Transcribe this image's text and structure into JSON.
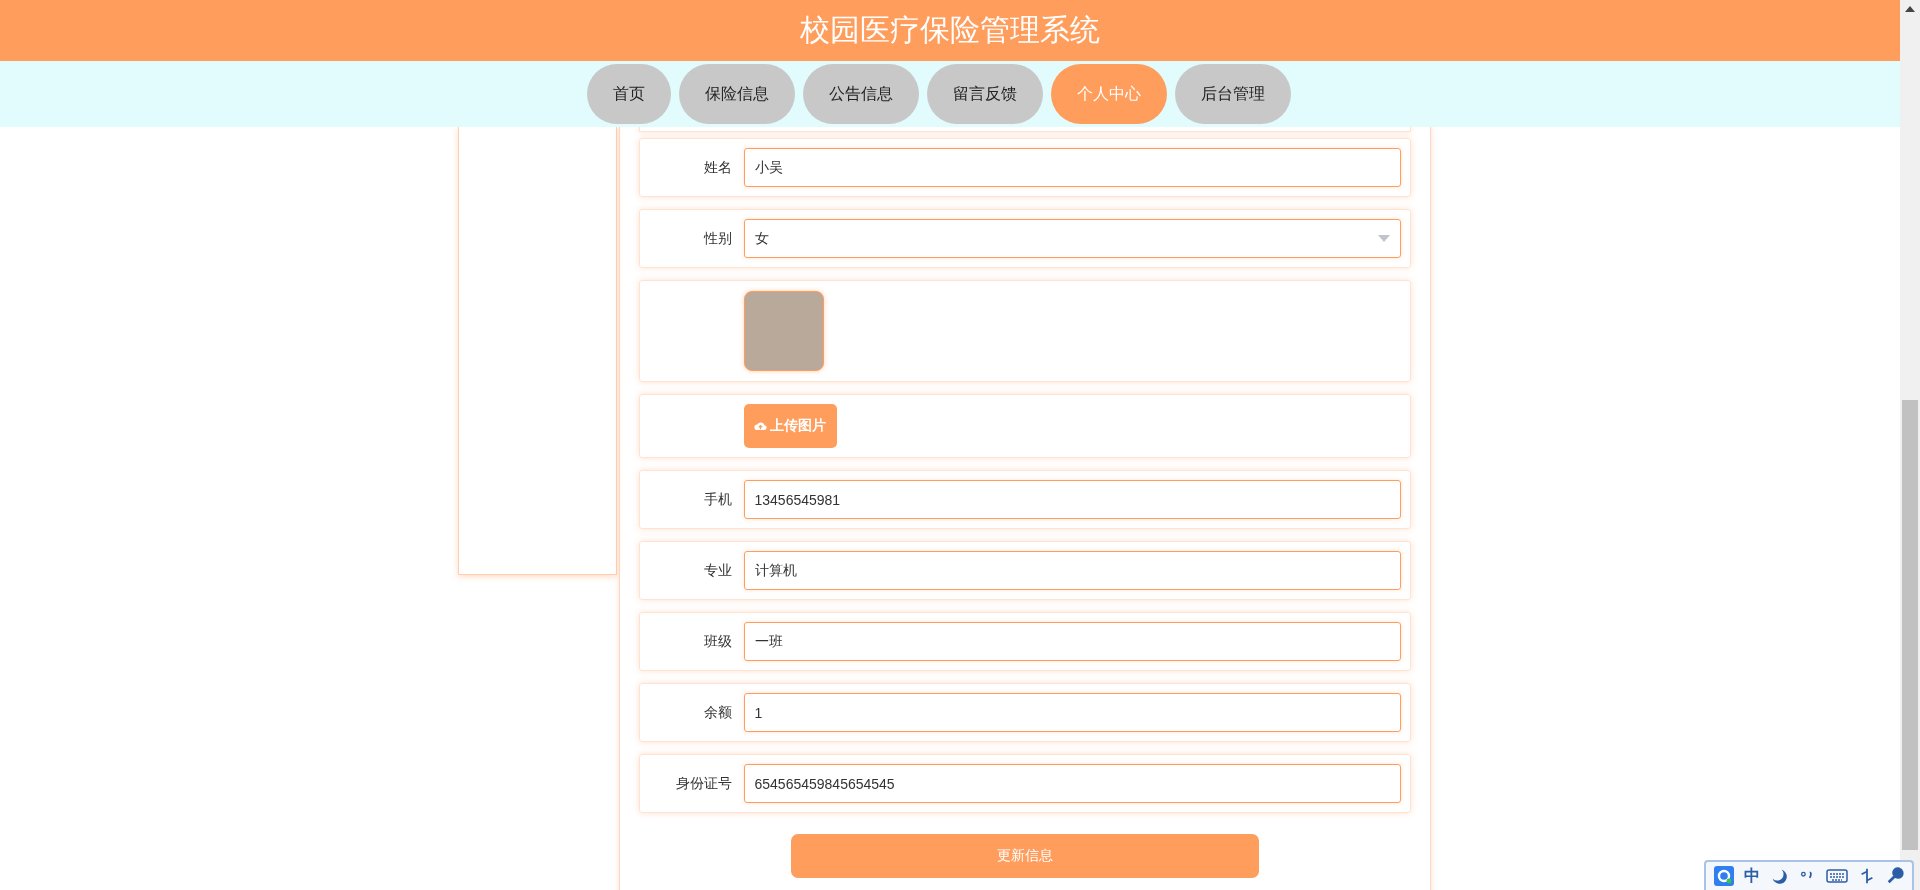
{
  "header": {
    "title": "校园医疗保险管理系统"
  },
  "nav": [
    {
      "label": "首页",
      "selected": false
    },
    {
      "label": "保险信息",
      "selected": false
    },
    {
      "label": "公告信息",
      "selected": false
    },
    {
      "label": "留言反馈",
      "selected": false
    },
    {
      "label": "个人中心",
      "selected": true
    },
    {
      "label": "后台管理",
      "selected": false
    }
  ],
  "form": {
    "fields": [
      {
        "kind": "text",
        "label": "姓名",
        "value": "小吴"
      },
      {
        "kind": "select",
        "label": "性别",
        "value": "女"
      },
      {
        "kind": "image"
      },
      {
        "kind": "upload",
        "button": "上传图片"
      },
      {
        "kind": "text",
        "label": "手机",
        "value": "13456545981"
      },
      {
        "kind": "text",
        "label": "专业",
        "value": "计算机"
      },
      {
        "kind": "text",
        "label": "班级",
        "value": "一班"
      },
      {
        "kind": "text",
        "label": "余额",
        "value": "1"
      },
      {
        "kind": "text",
        "label": "身份证号",
        "value": "654565459845654545"
      }
    ],
    "submit": "更新信息"
  },
  "ime": {
    "mode": "中"
  }
}
